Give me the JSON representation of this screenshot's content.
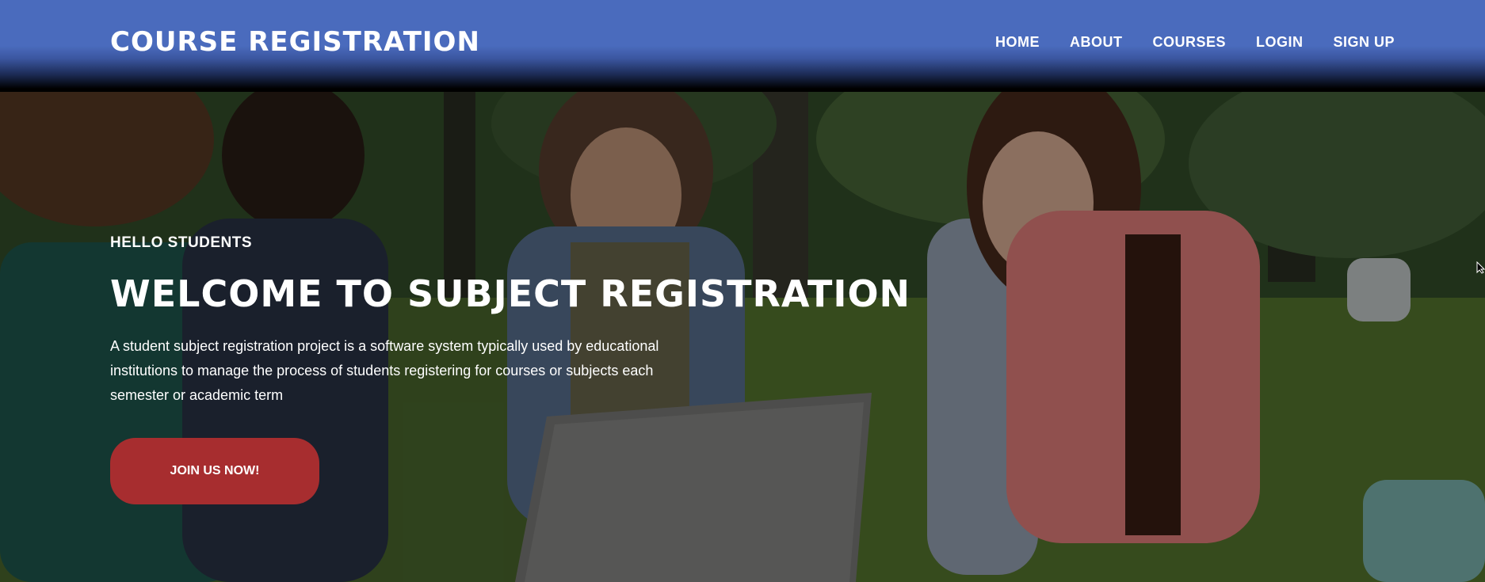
{
  "header": {
    "brand": "COURSE REGISTRATION",
    "nav": [
      {
        "label": "HOME"
      },
      {
        "label": "ABOUT"
      },
      {
        "label": "COURSES"
      },
      {
        "label": "LOGIN"
      },
      {
        "label": "SIGN UP"
      }
    ]
  },
  "hero": {
    "greeting": "HELLO STUDENTS",
    "headline": "WELCOME TO SUBJECT REGISTRATION",
    "description": "A student subject registration project is a software system typically used by educational institutions to manage the process of students registering for courses or subjects each semester or academic term",
    "cta_label": "JOIN US NOW!"
  },
  "colors": {
    "header_bg": "#4a6bbd",
    "cta_bg": "#a72d2f"
  }
}
